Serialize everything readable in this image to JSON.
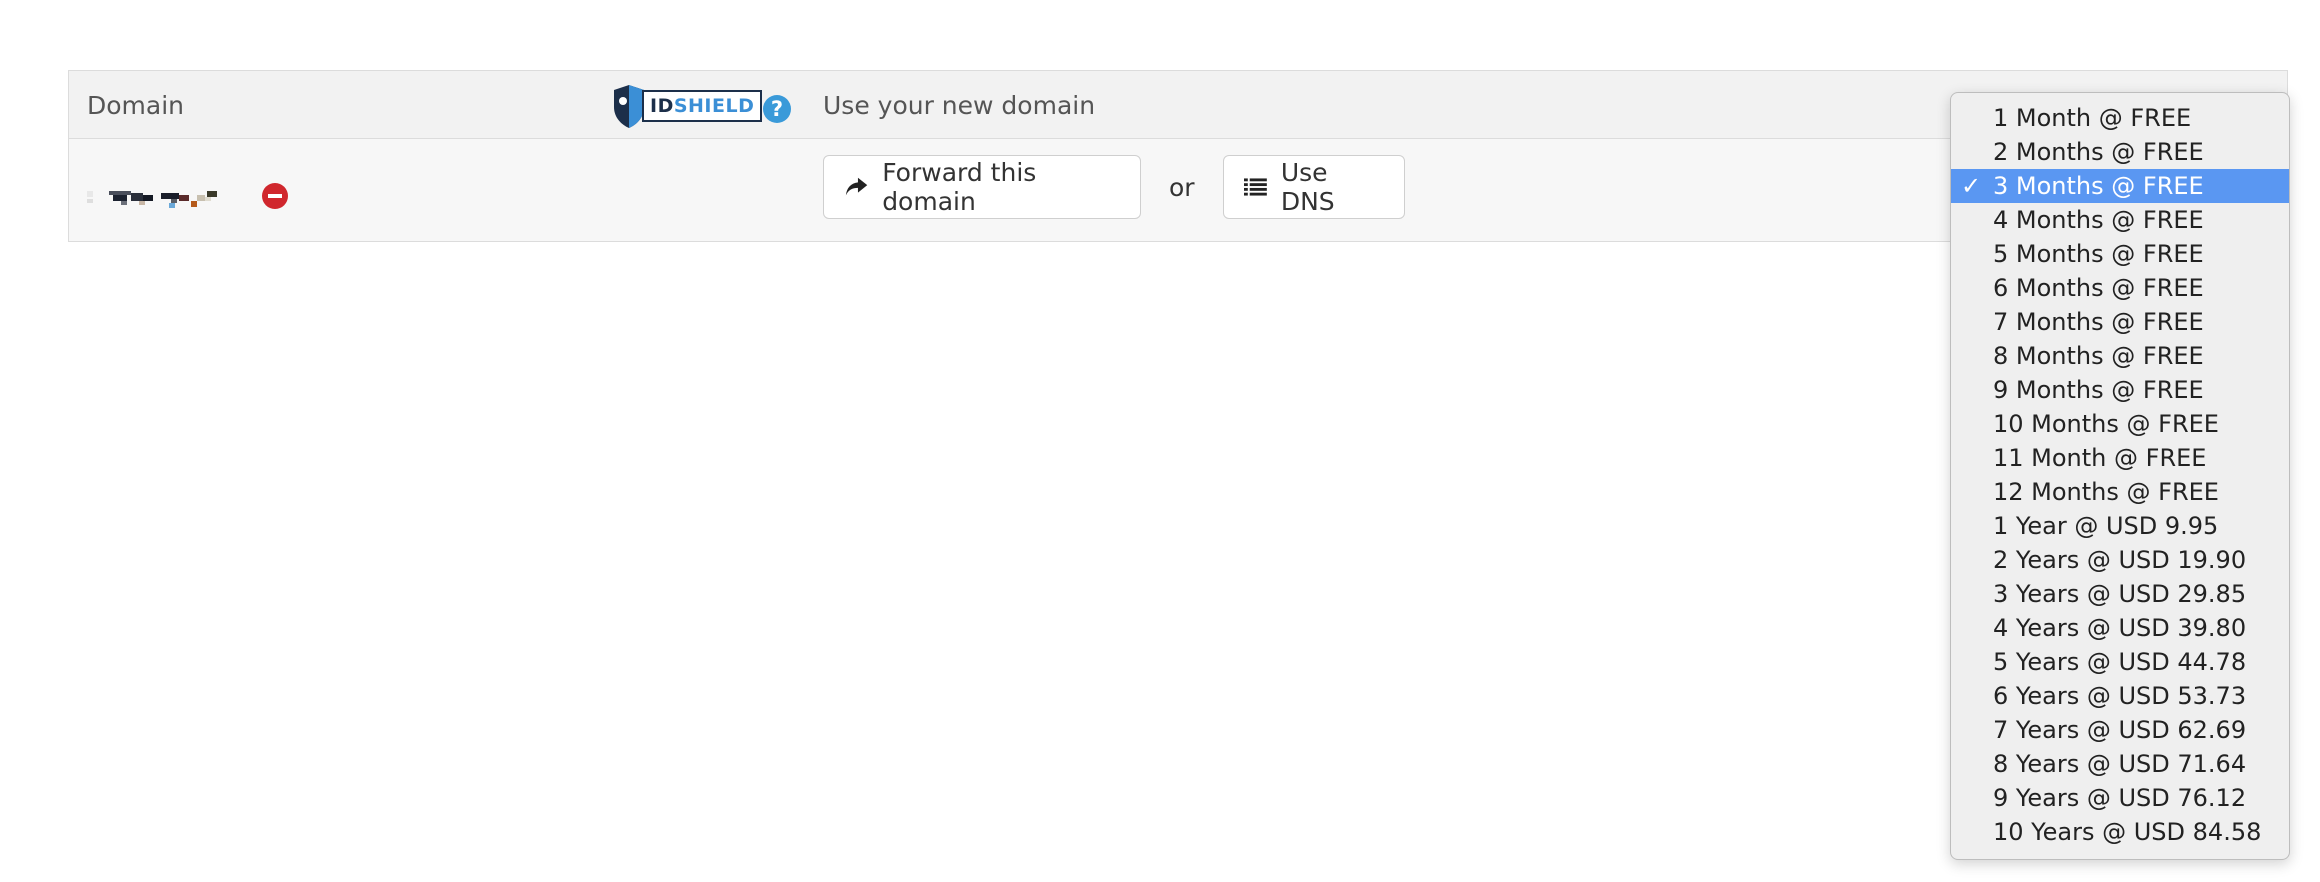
{
  "table": {
    "header": {
      "domain_label": "Domain",
      "idshield": {
        "id": "ID",
        "shield": "SHIELD"
      },
      "help_icon": "?",
      "use_label": "Use your new domain"
    },
    "row": {
      "forward_label": "Forward this domain",
      "or_label": "or",
      "dns_label": "Use DNS"
    }
  },
  "dropdown": {
    "selected_index": 2,
    "check_mark": "✓",
    "options": [
      "1 Month @ FREE",
      "2 Months @ FREE",
      "3 Months @ FREE",
      "4 Months @ FREE",
      "5 Months @ FREE",
      "6 Months @ FREE",
      "7 Months @ FREE",
      "8 Months @ FREE",
      "9 Months @ FREE",
      "10 Months @ FREE",
      "11 Month @ FREE",
      "12 Months @ FREE",
      "1 Year @ USD 9.95",
      "2 Years @ USD 19.90",
      "3 Years @ USD 29.85",
      "4 Years @ USD 39.80",
      "5 Years @ USD 44.78",
      "6 Years @ USD 53.73",
      "7 Years @ USD 62.69",
      "8 Years @ USD 71.64",
      "9 Years @ USD 76.12",
      "10 Years @ USD 84.58"
    ]
  },
  "colors": {
    "selected_bg": "#5a97f2",
    "remove_icon": "#d0272d",
    "help_icon": "#3a9ad9"
  }
}
